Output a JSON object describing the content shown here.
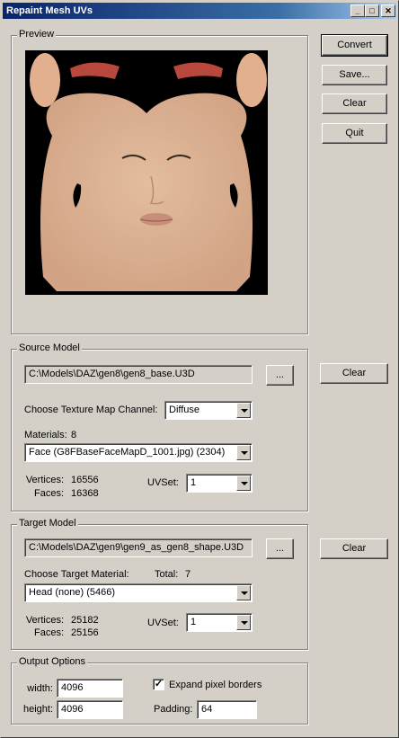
{
  "window": {
    "title": "Repaint Mesh UVs",
    "minimize": "_",
    "maximize": "□",
    "close": "✕"
  },
  "preview": {
    "label": "Preview"
  },
  "actions": {
    "convert": "Convert",
    "save": "Save...",
    "clear": "Clear",
    "quit": "Quit"
  },
  "source": {
    "label": "Source Model",
    "path": "C:\\Models\\DAZ\\gen8\\gen8_base.U3D",
    "browse": "...",
    "clear": "Clear",
    "channel_label": "Choose Texture Map Channel:",
    "channel_value": "Diffuse",
    "materials_label": "Materials:",
    "materials_count": "8",
    "material_value": "Face (G8FBaseFaceMapD_1001.jpg) (2304)",
    "vertices_label": "Vertices:",
    "vertices": "16556",
    "faces_label": "Faces:",
    "faces": "16368",
    "uvset_label": "UVSet:",
    "uvset_value": "1"
  },
  "target": {
    "label": "Target Model",
    "path": "C:\\Models\\DAZ\\gen9\\gen9_as_gen8_shape.U3D",
    "browse": "...",
    "clear": "Clear",
    "material_label": "Choose Target Material:",
    "total_label": "Total:",
    "total": "7",
    "material_value": "Head (none) (5466)",
    "vertices_label": "Vertices:",
    "vertices": "25182",
    "faces_label": "Faces:",
    "faces": "25156",
    "uvset_label": "UVSet:",
    "uvset_value": "1"
  },
  "output": {
    "label": "Output Options",
    "width_label": "width:",
    "width": "4096",
    "height_label": "height:",
    "height": "4096",
    "expand_label": "Expand pixel borders",
    "expand_checked": "✓",
    "padding_label": "Padding:",
    "padding": "64"
  }
}
